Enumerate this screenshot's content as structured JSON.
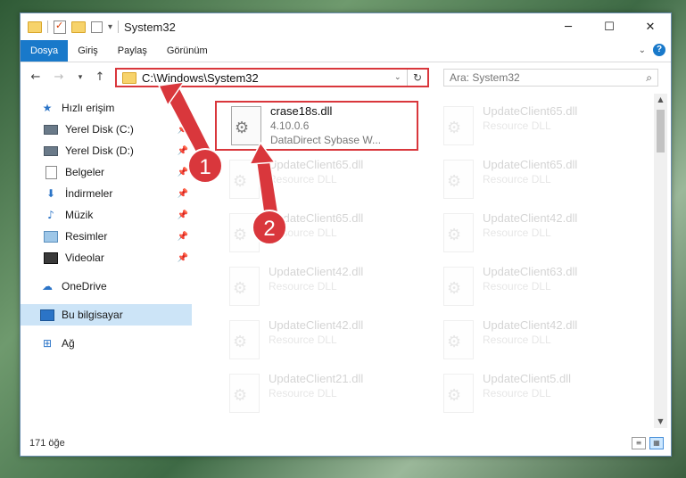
{
  "window": {
    "title": "System32"
  },
  "ribbon": {
    "tabs": [
      "Dosya",
      "Giriş",
      "Paylaş",
      "Görünüm"
    ]
  },
  "address": {
    "path": "C:\\Windows\\System32"
  },
  "search": {
    "placeholder": "Ara: System32"
  },
  "sidebar": {
    "quick_access": "Hızlı erişim",
    "items": [
      "Yerel Disk (C:)",
      "Yerel Disk (D:)",
      "Belgeler",
      "İndirmeler",
      "Müzik",
      "Resimler",
      "Videolar"
    ],
    "onedrive": "OneDrive",
    "this_pc": "Bu bilgisayar",
    "network": "Ağ"
  },
  "files": [
    {
      "name": "crase18s.dll",
      "line1": "4.10.0.6",
      "line2": "DataDirect Sybase W..."
    },
    {
      "name": "UpdateClient65.dll",
      "line1": "Resource DLL"
    },
    {
      "name": "UpdateClient65.dll",
      "line1": "Resource DLL"
    },
    {
      "name": "UpdateClient65.dll",
      "line1": "Resource DLL"
    },
    {
      "name": "UpdateClient65.dll",
      "line1": "Resource DLL"
    },
    {
      "name": "UpdateClient42.dll",
      "line1": "Resource DLL"
    },
    {
      "name": "UpdateClient42.dll",
      "line1": "Resource DLL"
    },
    {
      "name": "UpdateClient63.dll",
      "line1": "Resource DLL"
    },
    {
      "name": "UpdateClient42.dll",
      "line1": "Resource DLL"
    },
    {
      "name": "UpdateClient42.dll",
      "line1": "Resource DLL"
    },
    {
      "name": "UpdateClient21.dll",
      "line1": "Resource DLL"
    },
    {
      "name": "UpdateClient5.dll",
      "line1": "Resource DLL"
    }
  ],
  "status": {
    "count": "171 öğe"
  },
  "annotations": {
    "marker1": "1",
    "marker2": "2",
    "color": "#d9373c"
  },
  "icons": [
    "folder-icon",
    "checklist-icon",
    "properties-icon",
    "back-arrow-icon",
    "forward-arrow-icon",
    "up-arrow-icon",
    "refresh-icon",
    "search-icon",
    "star-icon",
    "pin-icon",
    "drive-icon",
    "document-icon",
    "download-icon",
    "music-icon",
    "pictures-icon",
    "videos-icon",
    "cloud-icon",
    "computer-icon",
    "network-icon",
    "dll-gear-icon"
  ]
}
